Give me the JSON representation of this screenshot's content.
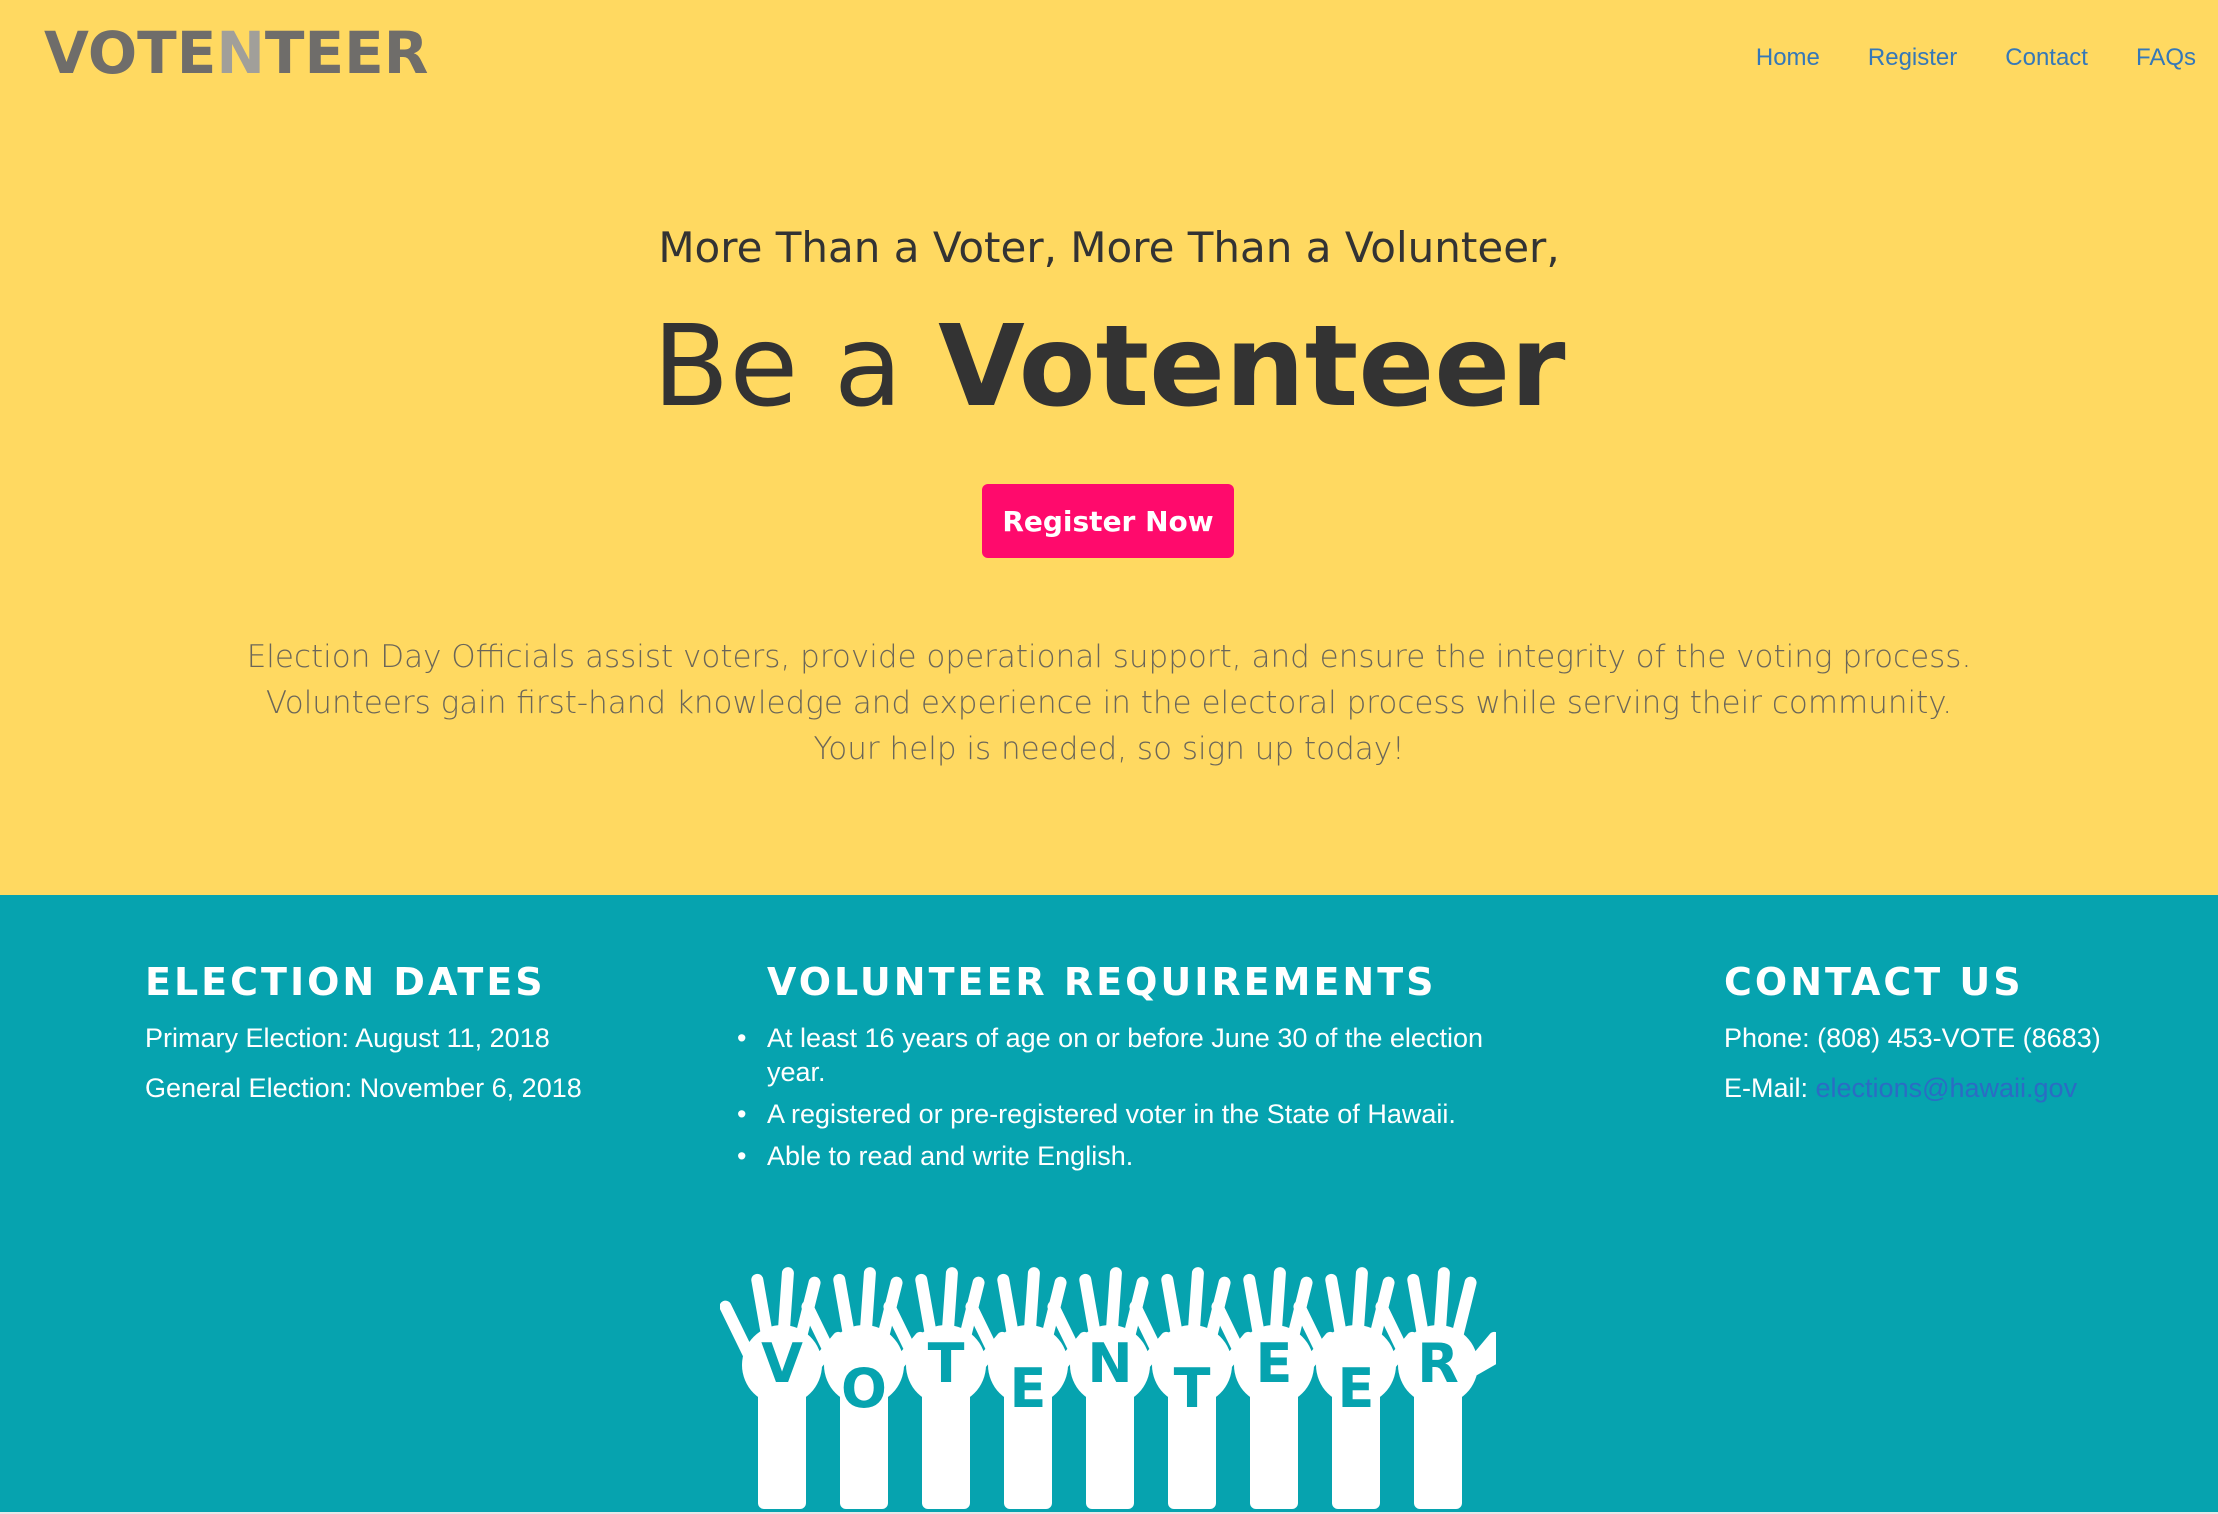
{
  "header": {
    "logo_left": "VOTE",
    "logo_mid": "N",
    "logo_right": "TEER",
    "nav": [
      "Home",
      "Register",
      "Contact",
      "FAQs"
    ]
  },
  "hero": {
    "tagline": "More Than a Voter, More Than a Volunteer,",
    "headline_prefix": "Be a ",
    "headline_strong": "Votenteer",
    "cta_label": "Register Now",
    "intro": [
      "Election Day Officials assist voters, provide operational support, and ensure the integrity of the voting process.",
      "Volunteers gain first-hand knowledge and experience in the electoral process while serving their community.",
      "Your help is needed, so sign up today!"
    ]
  },
  "election_dates": {
    "title": "ELECTION DATES",
    "primary": "Primary Election: August 11, 2018",
    "general": "General Election: November 6, 2018"
  },
  "requirements": {
    "title": "VOLUNTEER REQUIREMENTS",
    "items": [
      "At least 16 years of age on or before June 30 of the election year.",
      "A registered or pre-registered voter in the State of Hawaii.",
      "Able to read and write English."
    ]
  },
  "contact": {
    "title": "CONTACT US",
    "phone": "Phone: (808) 453-VOTE (8683)",
    "email_label": "E-Mail: ",
    "email": "elections@hawaii.gov"
  },
  "graphic": {
    "letters": [
      "V",
      "O",
      "T",
      "E",
      "N",
      "T",
      "E",
      "E",
      "R"
    ]
  },
  "colors": {
    "hero_bg": "#FFD961",
    "info_bg": "#06A3AF",
    "cta_bg": "#FF0A6C",
    "nav_link": "#3578B8"
  }
}
